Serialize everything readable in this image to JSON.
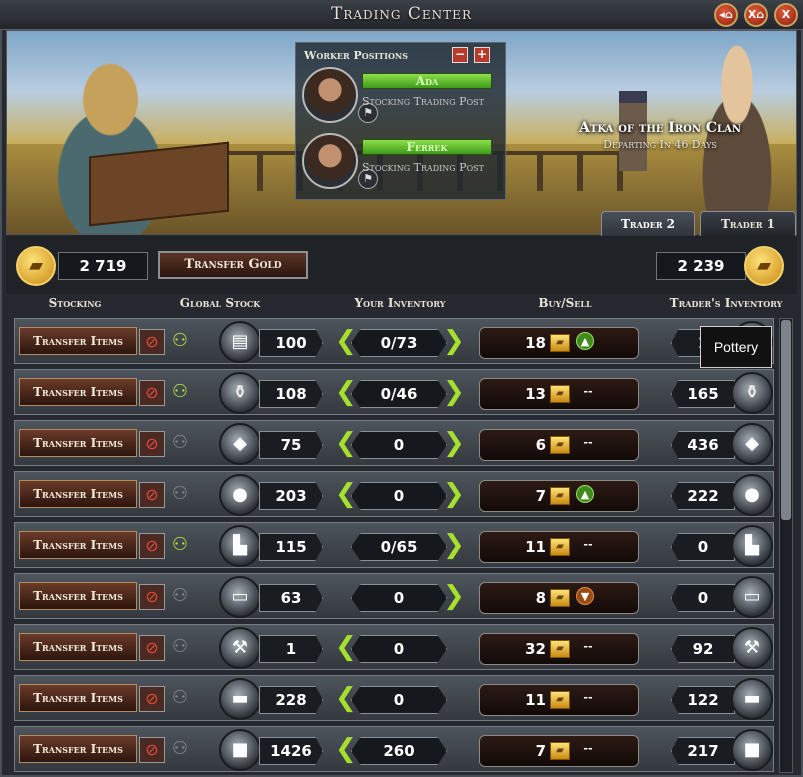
{
  "window": {
    "title": "Trading Center",
    "buttons": [
      {
        "label": "◂⌂",
        "name": "back-home-button"
      },
      {
        "label": "X⌂",
        "name": "close-home-button"
      },
      {
        "label": "X",
        "name": "close-button"
      }
    ]
  },
  "banner": {
    "trader_name": "Atka of the Iron Clan",
    "trader_status": "Departing In 46 Days"
  },
  "workers": {
    "header": "Worker Positions",
    "remove_label": "−",
    "add_label": "+",
    "list": [
      {
        "name": "Ada",
        "task": "Stocking Trading Post"
      },
      {
        "name": "Ferrek",
        "task": "Stocking Trading Post"
      }
    ]
  },
  "tabs": [
    {
      "label": "Trader 2",
      "active": true
    },
    {
      "label": "Trader 1",
      "active": false
    }
  ],
  "gold": {
    "your_gold": "2 719",
    "transfer_label": "Transfer Gold",
    "trader_gold": "2 239"
  },
  "columns": {
    "stocking": "Stocking",
    "global_stock": "Global Stock",
    "your_inventory": "Your Inventory",
    "buy_sell": "Buy/Sell",
    "traders_inventory": "Trader's Inventory"
  },
  "transfer_items_label": "Transfer Items",
  "tooltip": "Pottery",
  "rows": [
    {
      "icon": "cloth-icon",
      "stocking": true,
      "global": "100",
      "inv": "0/73",
      "left_arrow": true,
      "right_arrow": true,
      "price": "18",
      "trend": "up",
      "trader": "1"
    },
    {
      "icon": "pottery-icon",
      "stocking": true,
      "global": "108",
      "inv": "0/46",
      "left_arrow": true,
      "right_arrow": true,
      "price": "13",
      "trend": "none",
      "trader": "165"
    },
    {
      "icon": "ore-icon",
      "stocking": false,
      "global": "75",
      "inv": "0",
      "left_arrow": true,
      "right_arrow": true,
      "price": "6",
      "trend": "none",
      "trader": "436"
    },
    {
      "icon": "coal-icon",
      "stocking": false,
      "global": "203",
      "inv": "0",
      "left_arrow": true,
      "right_arrow": true,
      "price": "7",
      "trend": "up",
      "trader": "222"
    },
    {
      "icon": "boots-icon",
      "stocking": true,
      "global": "115",
      "inv": "0/65",
      "left_arrow": false,
      "right_arrow": true,
      "price": "11",
      "trend": "none",
      "trader": "0"
    },
    {
      "icon": "planks-icon",
      "stocking": false,
      "global": "63",
      "inv": "0",
      "left_arrow": false,
      "right_arrow": true,
      "price": "8",
      "trend": "down",
      "trader": "0"
    },
    {
      "icon": "tools-icon",
      "stocking": false,
      "global": "1",
      "inv": "0",
      "left_arrow": true,
      "right_arrow": false,
      "price": "32",
      "trend": "none",
      "trader": "92"
    },
    {
      "icon": "iron-icon",
      "stocking": false,
      "global": "228",
      "inv": "0",
      "left_arrow": true,
      "right_arrow": false,
      "price": "11",
      "trend": "none",
      "trader": "122"
    },
    {
      "icon": "stone-icon",
      "stocking": false,
      "global": "1426",
      "inv": "260",
      "left_arrow": true,
      "right_arrow": false,
      "price": "7",
      "trend": "none",
      "trader": "217"
    }
  ],
  "trend_none_text": "--",
  "colors": {
    "accent_green": "#a6e02c",
    "gold": "#f4d06a",
    "panel": "#262a30"
  }
}
